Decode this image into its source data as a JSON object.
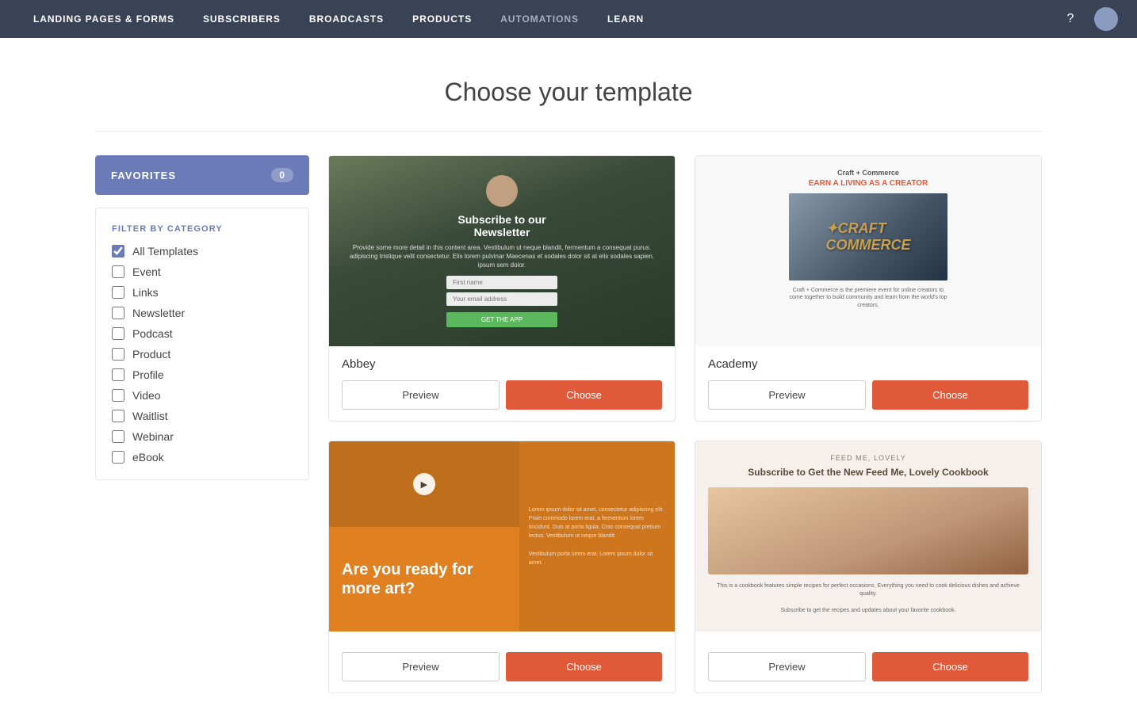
{
  "nav": {
    "items": [
      {
        "id": "landing-pages",
        "label": "Landing Pages & Forms",
        "active": true
      },
      {
        "id": "subscribers",
        "label": "Subscribers",
        "active": false
      },
      {
        "id": "broadcasts",
        "label": "Broadcasts",
        "active": false
      },
      {
        "id": "products",
        "label": "Products",
        "active": false
      },
      {
        "id": "automations",
        "label": "Automations",
        "active": true
      },
      {
        "id": "learn",
        "label": "Learn",
        "active": false
      }
    ],
    "help_icon": "?",
    "avatar_icon": "○"
  },
  "page": {
    "title": "Choose your template"
  },
  "sidebar": {
    "favorites_label": "FAVORITES",
    "favorites_count": "0",
    "filter_label": "FILTER BY CATEGORY",
    "categories": [
      {
        "id": "all",
        "label": "All Templates",
        "checked": true
      },
      {
        "id": "event",
        "label": "Event",
        "checked": false
      },
      {
        "id": "links",
        "label": "Links",
        "checked": false
      },
      {
        "id": "newsletter",
        "label": "Newsletter",
        "checked": false
      },
      {
        "id": "podcast",
        "label": "Podcast",
        "checked": false
      },
      {
        "id": "product",
        "label": "Product",
        "checked": false
      },
      {
        "id": "profile",
        "label": "Profile",
        "checked": false
      },
      {
        "id": "video",
        "label": "Video",
        "checked": false
      },
      {
        "id": "waitlist",
        "label": "Waitlist",
        "checked": false
      },
      {
        "id": "webinar",
        "label": "Webinar",
        "checked": false
      },
      {
        "id": "ebook",
        "label": "eBook",
        "checked": false
      }
    ]
  },
  "templates": [
    {
      "id": "abbey",
      "name": "Abbey",
      "preview_label": "Preview",
      "choose_label": "Choose"
    },
    {
      "id": "academy",
      "name": "Academy",
      "preview_label": "Preview",
      "choose_label": "Choose",
      "logo_line1": "Craft + Commerce",
      "logo_line2": "EARN A LIVING AS A CREATOR",
      "description": "Craft + Commerce is the premiere event for online creators to come together to build community and learn from the world's top creators."
    },
    {
      "id": "template3",
      "name": "",
      "preview_label": "Preview",
      "choose_label": "Choose",
      "headline": "Are you ready for more art?"
    },
    {
      "id": "template4",
      "name": "",
      "preview_label": "Preview",
      "choose_label": "Choose",
      "label": "FEED ME, LOVELY",
      "subtitle": "Subscribe to Get the New Feed Me, Lovely Cookbook"
    }
  ]
}
